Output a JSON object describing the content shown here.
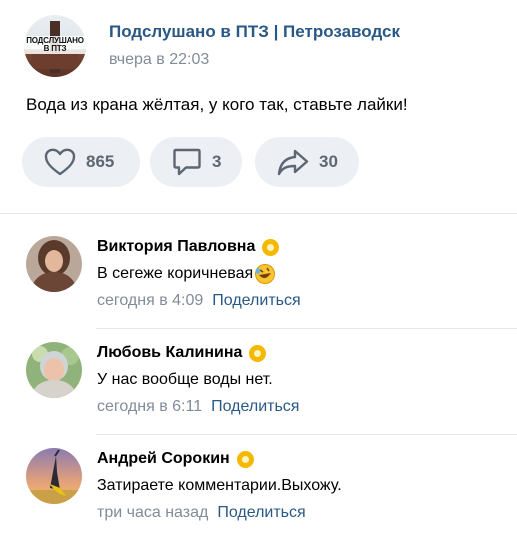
{
  "post": {
    "group_name": "Подслушано в ПТЗ | Петрозаводск",
    "group_avatar_text": "ПОДСЛУШАНО В ПТЗ",
    "time": "вчера в 22:03",
    "text": "Вода из крана жёлтая, у кого так, ставьте лайки!"
  },
  "actions": {
    "likes": "865",
    "comments": "3",
    "shares": "30"
  },
  "comments": [
    {
      "author": "Виктория Павловна",
      "text": "В сегеже коричневая",
      "emoji": "rolling-laughing-emoji",
      "time": "сегодня в 4:09",
      "share_label": "Поделиться"
    },
    {
      "author": "Любовь Калинина",
      "text": "У нас вообще воды нет.",
      "time": "сегодня в 6:11",
      "share_label": "Поделиться"
    },
    {
      "author": "Андрей Сорокин",
      "text": "Затираете комментарии.Выхожу.",
      "time": "три часа назад",
      "share_label": "Поделиться"
    }
  ],
  "colors": {
    "link": "#2a5885",
    "meta": "#818c99",
    "action_bg": "#eceff3",
    "action_fg": "#5c6773",
    "badge": "#f5b800"
  }
}
